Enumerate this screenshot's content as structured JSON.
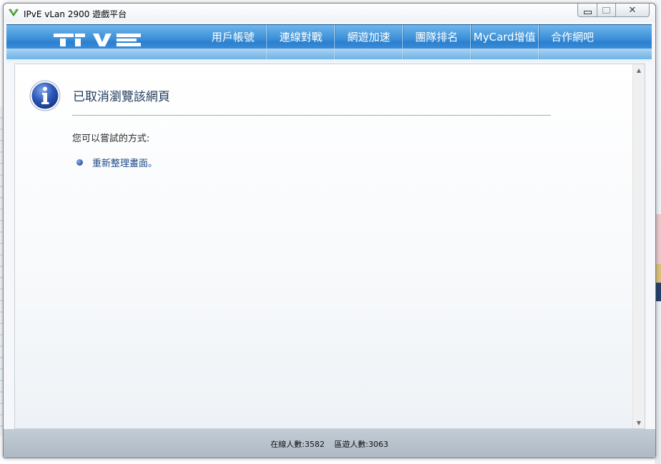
{
  "window": {
    "title": "IPvE vLan 2900 遊戲平台",
    "close_glyph": "✕"
  },
  "navbar": {
    "logo_name": "ipve-logo",
    "items": [
      {
        "label": "用戶帳號"
      },
      {
        "label": "連線對戰"
      },
      {
        "label": "網遊加速"
      },
      {
        "label": "團隊排名"
      },
      {
        "label": "MyCard增值"
      },
      {
        "label": "合作網吧"
      }
    ]
  },
  "content": {
    "heading": "已取消瀏覽該網頁",
    "subtext": "您可以嘗試的方式:",
    "suggestions": [
      {
        "label": "重新整理畫面。"
      }
    ],
    "scroll_up_glyph": "▲",
    "scroll_down_glyph": "▼"
  },
  "status": {
    "online_users": "在線人數:3582",
    "gaming_users": "區遊人數:3063"
  },
  "colors": {
    "accent_blue": "#2c7fcf",
    "heading": "#1f3a5c",
    "link": "#1e4a86"
  }
}
